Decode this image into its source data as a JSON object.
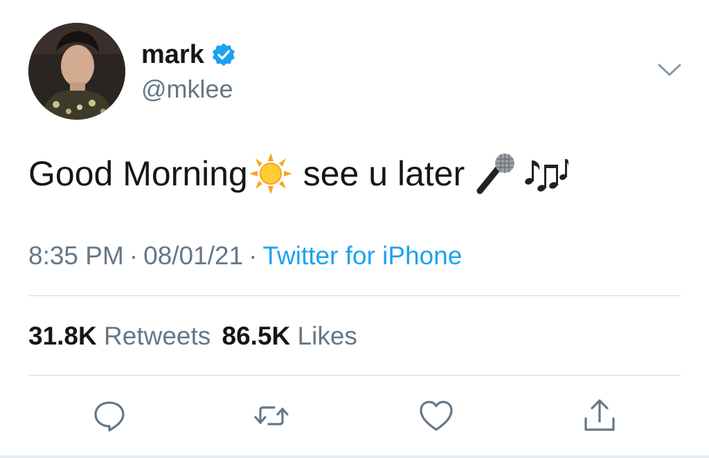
{
  "author": {
    "display_name": "mark",
    "handle": "@mklee",
    "verified": true
  },
  "tweet": {
    "text_part1": "Good Morning",
    "text_part2": " see u later ",
    "emojis": [
      "sun-emoji",
      "microphone-emoji",
      "musical-notes-emoji"
    ],
    "time": "8:35 PM",
    "separator": "·",
    "date": "08/01/21",
    "source": "Twitter for iPhone"
  },
  "stats": {
    "retweets_count": "31.8K",
    "retweets_label": "Retweets",
    "likes_count": "86.5K",
    "likes_label": "Likes"
  },
  "actions": [
    "reply-icon",
    "retweet-icon",
    "like-icon",
    "share-icon"
  ],
  "colors": {
    "text": "#14171a",
    "secondary": "#657786",
    "accent": "#1da1f2",
    "divider": "#d6dbe0"
  }
}
